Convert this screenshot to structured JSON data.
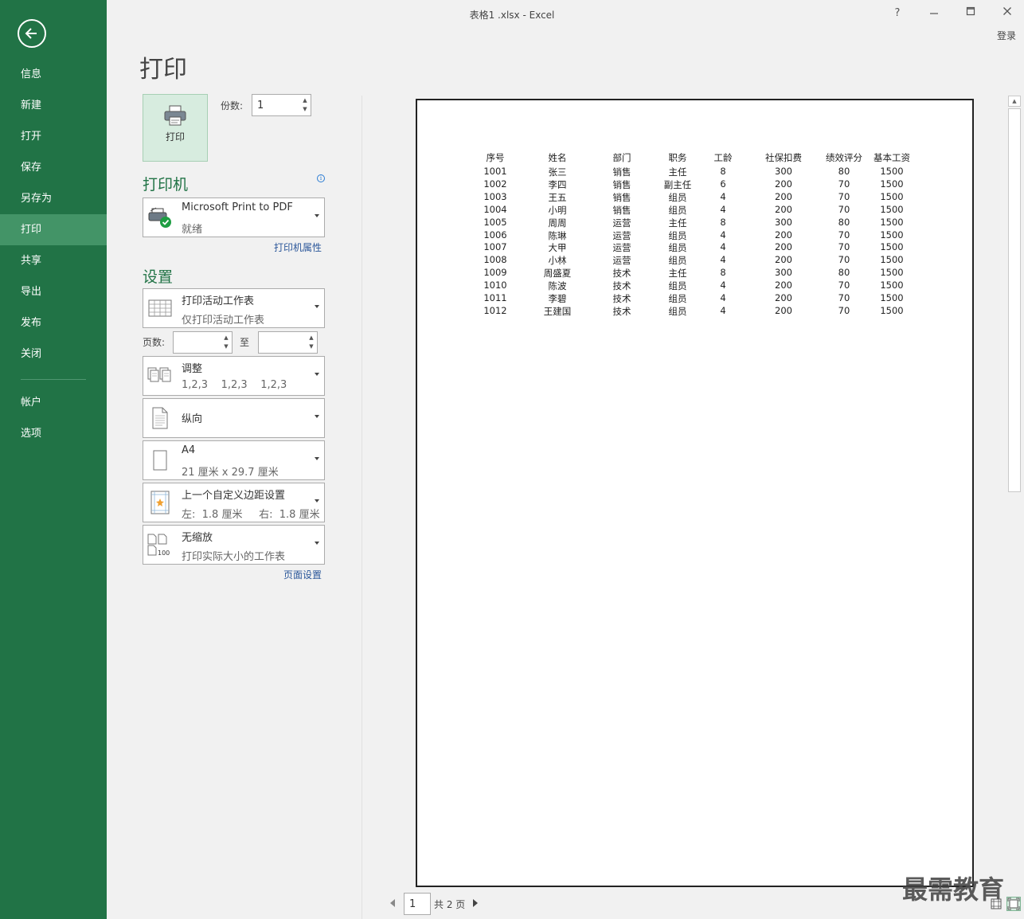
{
  "window": {
    "title": "表格1 .xlsx - Excel",
    "help_label": "?",
    "signin_label": "登录"
  },
  "nav": {
    "items": [
      {
        "label": "信息"
      },
      {
        "label": "新建"
      },
      {
        "label": "打开"
      },
      {
        "label": "保存"
      },
      {
        "label": "另存为"
      },
      {
        "label": "打印",
        "active": true
      },
      {
        "label": "共享"
      },
      {
        "label": "导出"
      },
      {
        "label": "发布"
      },
      {
        "label": "关闭"
      },
      {
        "label": "帐户"
      },
      {
        "label": "选项"
      }
    ]
  },
  "print": {
    "heading": "打印",
    "button_label": "打印",
    "copies_label": "份数:",
    "copies_value": "1"
  },
  "printer": {
    "section_title": "打印机",
    "name": "Microsoft Print to PDF",
    "status": "就绪",
    "properties_link": "打印机属性"
  },
  "settings": {
    "section_title": "设置",
    "scope": {
      "main": "打印活动工作表",
      "sub": "仅打印活动工作表"
    },
    "pages_label": "页数:",
    "pages_to": "至",
    "pages_from_value": "",
    "pages_to_value": "",
    "collate": {
      "main": "调整",
      "sub": "1,2,3    1,2,3    1,2,3"
    },
    "orientation": {
      "main": "纵向"
    },
    "paper": {
      "main": "A4",
      "sub": "21 厘米 x 29.7 厘米"
    },
    "margins": {
      "main": "上一个自定义边距设置",
      "sub": "左:  1.8 厘米     右:  1.8 厘米"
    },
    "scaling": {
      "main": "无缩放",
      "sub": "打印实际大小的工作表",
      "icon_text": "100"
    },
    "page_setup_link": "页面设置"
  },
  "preview": {
    "headers": [
      "序号",
      "姓名",
      "部门",
      "职务",
      "工龄",
      "社保扣费",
      "绩效评分",
      "基本工资"
    ],
    "rows": [
      [
        "1001",
        "张三",
        "销售",
        "主任",
        "8",
        "300",
        "80",
        "1500"
      ],
      [
        "1002",
        "李四",
        "销售",
        "副主任",
        "6",
        "200",
        "70",
        "1500"
      ],
      [
        "1003",
        "王五",
        "销售",
        "组员",
        "4",
        "200",
        "70",
        "1500"
      ],
      [
        "1004",
        "小明",
        "销售",
        "组员",
        "4",
        "200",
        "70",
        "1500"
      ],
      [
        "1005",
        "周周",
        "运营",
        "主任",
        "8",
        "300",
        "80",
        "1500"
      ],
      [
        "1006",
        "陈琳",
        "运营",
        "组员",
        "4",
        "200",
        "70",
        "1500"
      ],
      [
        "1007",
        "大甲",
        "运营",
        "组员",
        "4",
        "200",
        "70",
        "1500"
      ],
      [
        "1008",
        "小林",
        "运营",
        "组员",
        "4",
        "200",
        "70",
        "1500"
      ],
      [
        "1009",
        "周盛夏",
        "技术",
        "主任",
        "8",
        "300",
        "80",
        "1500"
      ],
      [
        "1010",
        "陈波",
        "技术",
        "组员",
        "4",
        "200",
        "70",
        "1500"
      ],
      [
        "1011",
        "李碧",
        "技术",
        "组员",
        "4",
        "200",
        "70",
        "1500"
      ],
      [
        "1012",
        "王建国",
        "技术",
        "组员",
        "4",
        "200",
        "70",
        "1500"
      ]
    ]
  },
  "pager": {
    "current": "1",
    "total_label": "共 2 页"
  },
  "watermark": "最需教育",
  "icons": {
    "back": "back-arrow-icon",
    "printer_button": "printer-icon",
    "printer_device": "printer-ready-icon",
    "scope": "sheet-grid-icon",
    "collate": "collate-pages-icon",
    "orientation": "portrait-page-icon",
    "paper": "paper-size-icon",
    "margins": "margins-icon",
    "scaling": "no-scaling-icon"
  },
  "colors": {
    "brand": "#217346",
    "nav_active": "#439467",
    "link": "#2b579a"
  }
}
